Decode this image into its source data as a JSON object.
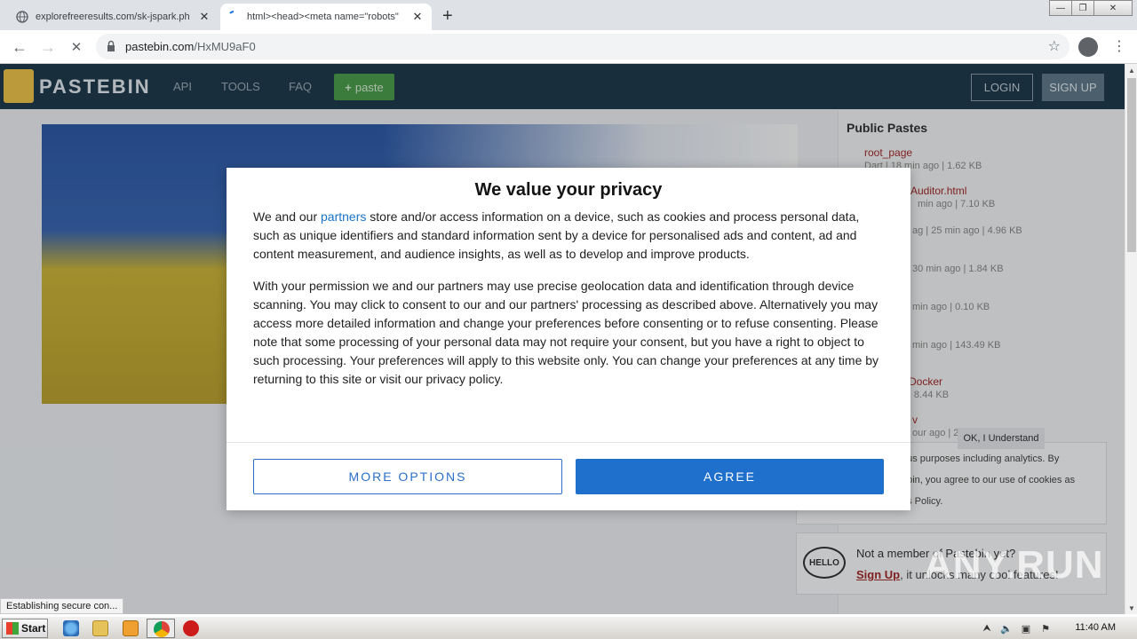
{
  "browser": {
    "tabs": [
      {
        "title": "explorefreeresults.com/sk-jspark.ph",
        "close": "✕"
      },
      {
        "title": "html><head><meta name=\"robots\"",
        "close": "✕"
      }
    ],
    "new_tab": "+",
    "window_controls": {
      "minimize": "—",
      "restore": "❐",
      "close": "✕"
    },
    "nav": {
      "back": "←",
      "forward": "→",
      "reload": "✕"
    },
    "url_host": "pastebin.com",
    "url_path": "/HxMU9aF0",
    "star": "☆",
    "menu": "⋮"
  },
  "site": {
    "logo": "PASTEBIN",
    "nav": [
      "API",
      "TOOLS",
      "FAQ"
    ],
    "paste_button": "paste",
    "login": "LOGIN",
    "signup": "SIGN UP",
    "sidebar_title": "Public Pastes",
    "pastes": [
      {
        "name": "root_page",
        "meta": "Dart | 18 min ago | 1.62 KB"
      },
      {
        "name": "Auditor.html",
        "meta": "min ago | 7.10 KB"
      },
      {
        "name": "",
        "meta": "ag | 25 min ago | 4.96 KB"
      },
      {
        "name": "",
        "meta": "30 min ago | 1.84 KB"
      },
      {
        "name": "",
        "meta": "min ago | 0.10 KB"
      },
      {
        "name": "",
        "meta": "min ago | 143.49 KB"
      },
      {
        "name": "Docker",
        "meta": "| 8.44 KB"
      },
      {
        "name": "v",
        "meta": "our ago | 2.70 KB"
      }
    ],
    "cookie_lines": [
      "ous purposes including analytics. By",
      "ebin, you agree to our use of cookies as",
      "es Policy."
    ],
    "cookie_ok": "OK, I Understand",
    "hello_icon": "HELLO",
    "hello_title": "Not a member of Pastebin yet?",
    "hello_signup": "Sign Up",
    "hello_rest": ", it unlocks many cool features!"
  },
  "modal": {
    "title": "We value your privacy",
    "p1_before": "We and our ",
    "p1_link": "partners",
    "p1_after": " store and/or access information on a device, such as cookies and process personal data, such as unique identifiers and standard information sent by a device for personalised ads and content, ad and content measurement, and audience insights, as well as to develop and improve products.",
    "p2": "With your permission we and our partners may use precise geolocation data and identification through device scanning. You may click to consent to our and our partners' processing as described above. Alternatively you may access more detailed information and change your preferences before consenting or to refuse consenting. Please note that some processing of your personal data may not require your consent, but you have a right to object to such processing. Your preferences will apply to this website only. You can change your preferences at any time by returning to this site or visit our privacy policy.",
    "more_options": "MORE OPTIONS",
    "agree": "AGREE"
  },
  "status_bubble": "Establishing secure con...",
  "watermark": "ANY.RUN",
  "taskbar": {
    "start": "Start",
    "clock": "11:40 AM"
  },
  "colors": {
    "pastebin_header": "#1e3a4c",
    "agree_button": "#1f6fcc",
    "link_blue": "#1a73c9",
    "paste_link": "#a02a2a"
  }
}
